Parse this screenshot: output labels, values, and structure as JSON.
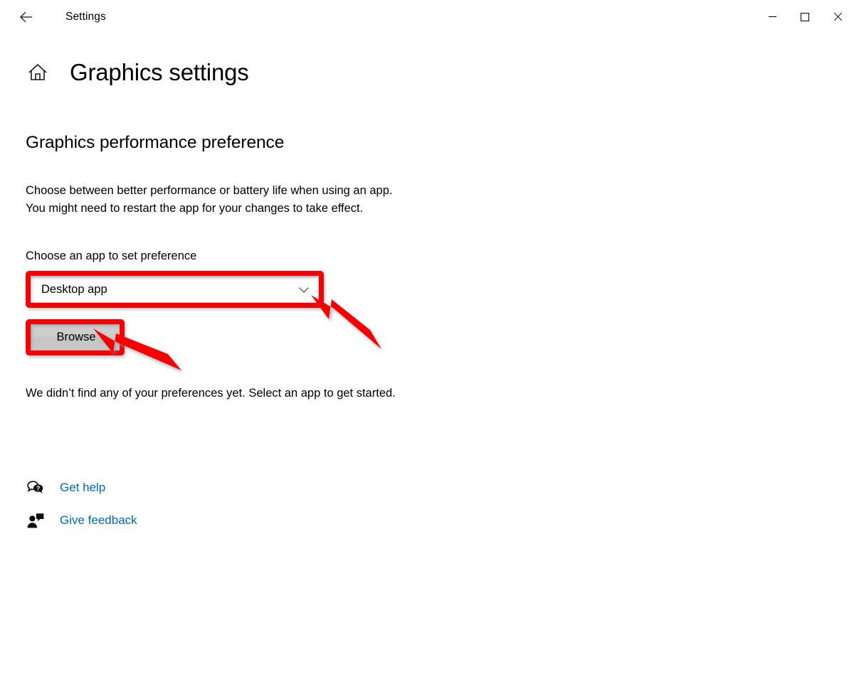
{
  "window": {
    "back_label": "Back",
    "title": "Settings",
    "controls": [
      {
        "name": "minimize",
        "glyph": "minimize-icon"
      },
      {
        "name": "maximize",
        "glyph": "maximize-icon"
      },
      {
        "name": "close",
        "glyph": "close-icon"
      }
    ]
  },
  "page": {
    "home_icon": "home-icon",
    "title": "Graphics settings",
    "section_title": "Graphics performance preference",
    "description_line1": "Choose between better performance or battery life when using an app.",
    "description_line2": "You might need to restart the app for your changes to take effect.",
    "field_label": "Choose an app to set preference",
    "combo": {
      "value": "Desktop app",
      "chevron": "chevron-down-icon"
    },
    "browse_button": "Browse",
    "status_text": "We didn’t find any of your preferences yet. Select an app to get started."
  },
  "footer": {
    "links": [
      {
        "icon": "help-bubble-icon",
        "label": "Get help"
      },
      {
        "icon": "feedback-person-icon",
        "label": "Give feedback"
      }
    ]
  },
  "annotations": {
    "highlight_color": "#f40000",
    "link_color": "#0067c0",
    "shapes": [
      {
        "type": "rectangle",
        "target": "combo-box"
      },
      {
        "type": "rectangle",
        "target": "browse-button"
      },
      {
        "type": "arrow",
        "target": "combo-chevron"
      },
      {
        "type": "arrow",
        "target": "browse-button"
      }
    ]
  }
}
